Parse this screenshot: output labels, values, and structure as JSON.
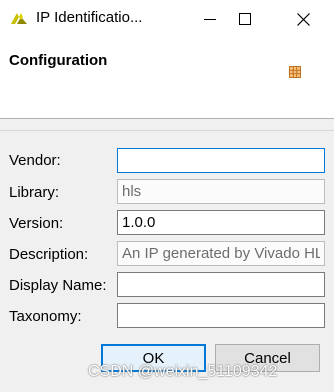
{
  "window": {
    "title": "IP Identificatio...",
    "app_icon": "vivado-logo-icon"
  },
  "header": {
    "title": "Configuration",
    "icon": "grid-config-icon"
  },
  "form": {
    "vendor": {
      "label": "Vendor:",
      "value": ""
    },
    "library": {
      "label": "Library:",
      "value": "hls"
    },
    "version": {
      "label": "Version:",
      "value": "1.0.0"
    },
    "description": {
      "label": "Description:",
      "value": "An IP generated by Vivado HLS"
    },
    "display_name": {
      "label": "Display Name:",
      "value": ""
    },
    "taxonomy": {
      "label": "Taxonomy:",
      "value": ""
    }
  },
  "buttons": {
    "ok": "OK",
    "cancel": "Cancel"
  },
  "watermark": "CSDN @weixin_51109342",
  "colors": {
    "focus_border": "#0078d7",
    "logo_primary": "#b9b100",
    "header_icon": "#d4883a"
  }
}
